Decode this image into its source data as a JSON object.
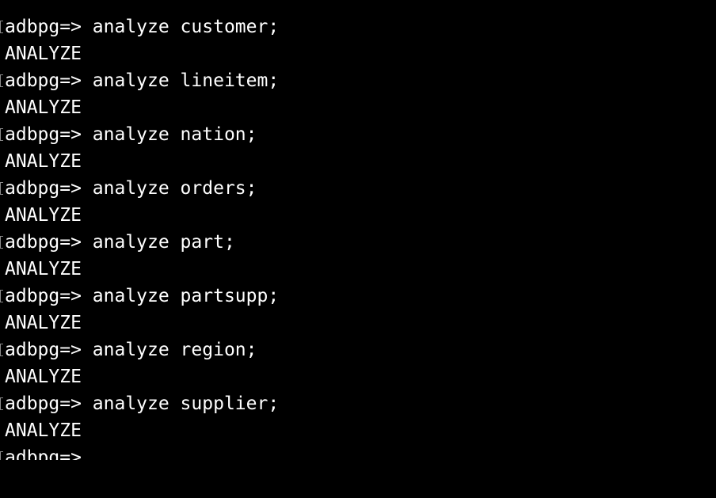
{
  "terminal": {
    "prompt": "adbpg=>",
    "entries": [
      {
        "command": " analyze customer;",
        "output": "ANALYZE"
      },
      {
        "command": " analyze lineitem;",
        "output": "ANALYZE"
      },
      {
        "command": " analyze nation;",
        "output": "ANALYZE"
      },
      {
        "command": " analyze orders;",
        "output": "ANALYZE"
      },
      {
        "command": " analyze part;",
        "output": "ANALYZE"
      },
      {
        "command": " analyze partsupp;",
        "output": "ANALYZE"
      },
      {
        "command": " analyze region;",
        "output": "ANALYZE"
      },
      {
        "command": " analyze supplier;",
        "output": "ANALYZE"
      }
    ],
    "final_prompt": "adbpg=>"
  }
}
